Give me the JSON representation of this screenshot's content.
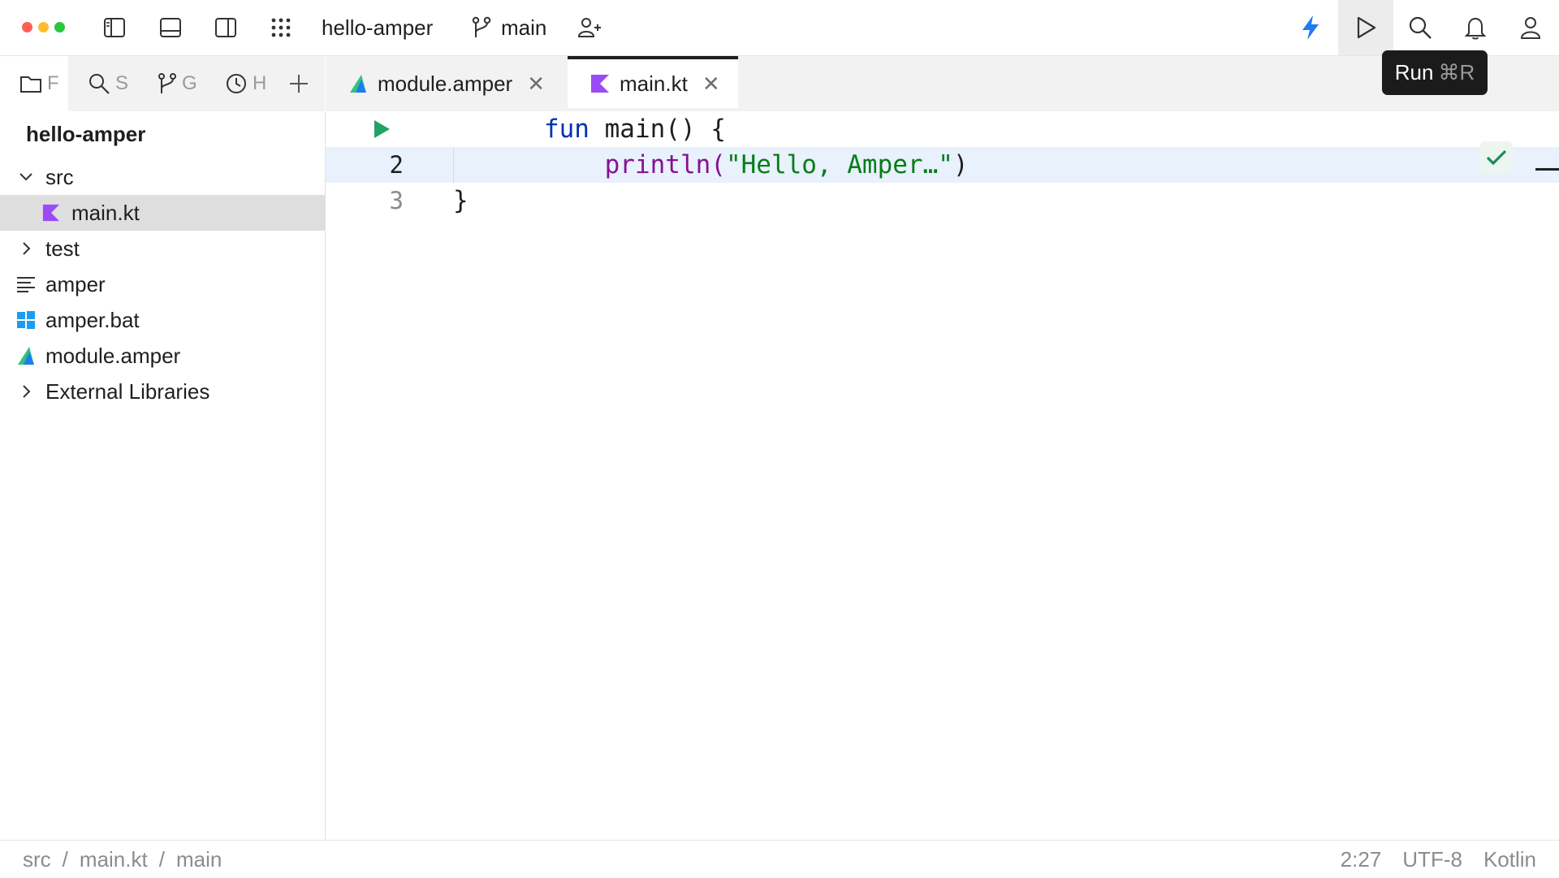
{
  "titlebar": {
    "project": "hello-amper",
    "branch": "main",
    "icons": [
      "sidebar-left-icon",
      "panel-bottom-icon",
      "sidebar-right-icon",
      "apps-grid-icon",
      "branch-icon",
      "add-user-icon",
      "lightning-icon",
      "run-icon",
      "search-icon",
      "bell-icon",
      "user-icon"
    ],
    "colors": {
      "close": "#ff5f57",
      "minimize": "#febc2e",
      "maximize": "#28c840",
      "accent": "#1e7bf2"
    }
  },
  "tool_tabs": [
    {
      "icon": "folder-icon",
      "label": "F"
    },
    {
      "icon": "search-icon",
      "label": "S"
    },
    {
      "icon": "git-icon",
      "label": "G"
    },
    {
      "icon": "clock-icon",
      "label": "H"
    },
    {
      "icon": "plus-icon",
      "label": ""
    }
  ],
  "editor_tabs": [
    {
      "label": "module.amper",
      "icon": "amper-icon",
      "active": false
    },
    {
      "label": "main.kt",
      "icon": "kotlin-icon",
      "active": true
    }
  ],
  "project_tree": {
    "root": "hello-amper",
    "items": [
      {
        "label": "src",
        "type": "folder-open"
      },
      {
        "label": "main.kt",
        "type": "kotlin",
        "selected": true
      },
      {
        "label": "test",
        "type": "folder-closed"
      },
      {
        "label": "amper",
        "type": "text"
      },
      {
        "label": "amper.bat",
        "type": "windows"
      },
      {
        "label": "module.amper",
        "type": "amper"
      },
      {
        "label": "External Libraries",
        "type": "folder-closed"
      }
    ]
  },
  "editor": {
    "lines": [
      {
        "number": "",
        "kw": "fun",
        "rest": " main() {"
      },
      {
        "number": "2",
        "indent": "    ",
        "call": "println(",
        "str": "\"Hello, Amper…\"",
        "close": ")"
      },
      {
        "number": "3",
        "text": "}"
      }
    ],
    "current_line": 2
  },
  "tooltip": {
    "label": "Run",
    "shortcut": "⌘R"
  },
  "statusbar": {
    "breadcrumb": [
      "src",
      "main.kt",
      "main"
    ],
    "separator": "/",
    "position": "2:27",
    "encoding": "UTF-8",
    "language": "Kotlin"
  }
}
